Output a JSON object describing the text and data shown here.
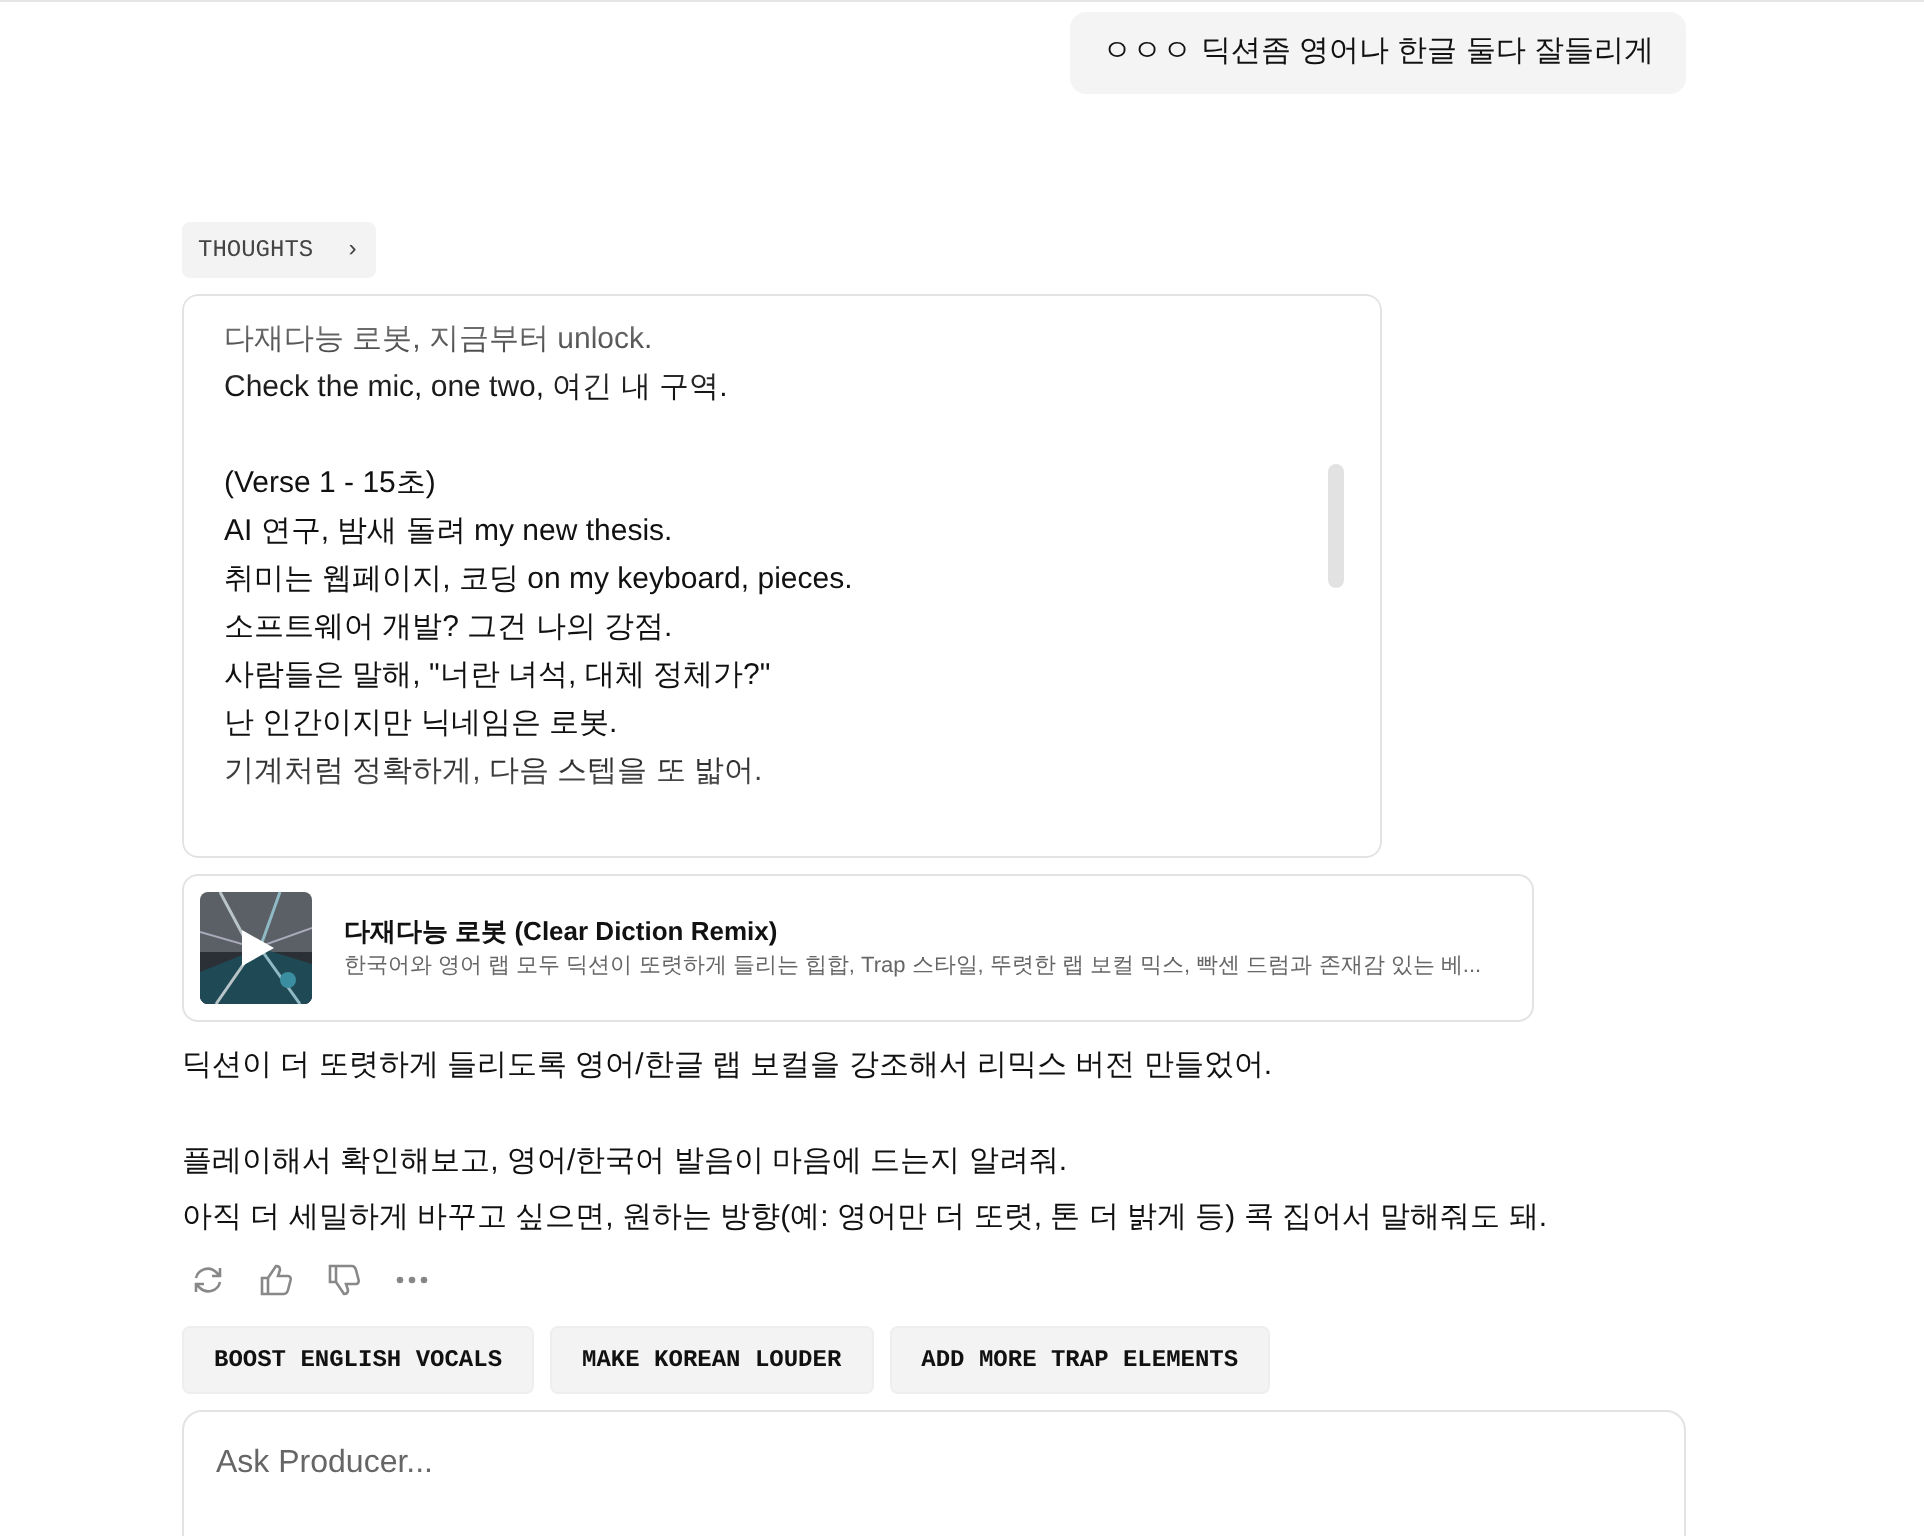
{
  "user_message": "ㅇㅇㅇ 딕션좀 영어나 한글 둘다 잘들리게",
  "thoughts": {
    "label": "THOUGHTS",
    "chevron": "›",
    "expanded": false
  },
  "lyrics": [
    {
      "lines": [
        "다재다능 로봇, 지금부터 unlock.",
        "Check the mic, one two, 여긴 내 구역."
      ]
    },
    {
      "lines": [
        "(Verse 1 - 15초)",
        "AI 연구, 밤새 돌려 my new thesis.",
        "취미는 웹페이지, 코딩 on my keyboard, pieces.",
        "소프트웨어 개발? 그건 나의 강점.",
        "사람들은 말해, \"너란 녀석, 대체 정체가?\"",
        "난 인간이지만 닉네임은 로봇.",
        "기계처럼 정확하게, 다음 스텝을 또 밟어."
      ]
    }
  ],
  "track": {
    "title": "다재다능 로봇 (Clear Diction Remix)",
    "description": "한국어와 영어 랩 모두 딕션이 또렷하게 들리는 힙합, Trap 스타일, 뚜렷한 랩 보컬 믹스, 빡센 드럼과 존재감 있는 베..."
  },
  "response": [
    {
      "lines": [
        "딕션이 더 또렷하게 들리도록 영어/한글 랩 보컬을 강조해서 리믹스 버전 만들었어."
      ]
    },
    {
      "lines": [
        "플레이해서 확인해보고, 영어/한국어 발음이 마음에 드는지 알려줘.",
        "아직 더 세밀하게 바꾸고 싶으면, 원하는 방향(예: 영어만 더 또렷, 톤 더 밝게 등) 콕 집어서 말해줘도 돼."
      ]
    }
  ],
  "actions": [
    {
      "kind": "retry"
    },
    {
      "kind": "like"
    },
    {
      "kind": "dislike"
    },
    {
      "kind": "more"
    }
  ],
  "suggestions": [
    "BOOST ENGLISH VOCALS",
    "MAKE KOREAN LOUDER",
    "ADD MORE TRAP ELEMENTS"
  ],
  "composer": {
    "placeholder": "Ask Producer..."
  }
}
